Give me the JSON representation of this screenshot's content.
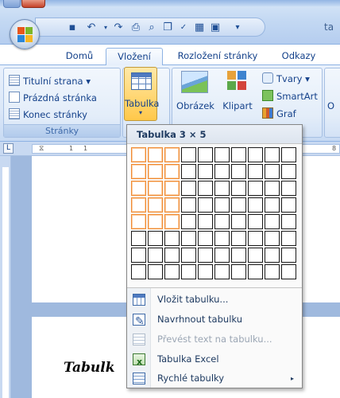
{
  "window": {
    "title_fragment": "ta"
  },
  "tabs": [
    {
      "label": "Domů",
      "active": false
    },
    {
      "label": "Vložení",
      "active": true
    },
    {
      "label": "Rozložení stránky",
      "active": false
    },
    {
      "label": "Odkazy",
      "active": false
    }
  ],
  "ribbon": {
    "pages_group": {
      "label": "Stránky",
      "items": [
        "Titulní strana ▾",
        "Prázdná stránka",
        "Konec stránky"
      ]
    },
    "table_button": {
      "label": "Tabulka",
      "arrow": "▾"
    },
    "picture_button": {
      "label": "Obrázek"
    },
    "clipart_button": {
      "label": "Klipart"
    },
    "shapes_button": {
      "label": "Tvary ▾"
    },
    "smartart_button": {
      "label": "SmartArt"
    },
    "chart_button": {
      "label": "Graf"
    },
    "cut_letter": "O"
  },
  "ruler": {
    "numbers": [
      "1",
      "1",
      "8"
    ]
  },
  "table_menu": {
    "header": "Tabulka 3 × 5",
    "grid": {
      "columns": 10,
      "rows": 8,
      "selected_columns": 3,
      "selected_rows": 5
    },
    "items": [
      {
        "label": "Vložit tabulku...",
        "icon": "insert-table-icon",
        "enabled": true
      },
      {
        "label": "Navrhnout tabulku",
        "icon": "draw-table-icon",
        "enabled": true
      },
      {
        "label": "Převést text na tabulku...",
        "icon": "convert-text-icon",
        "enabled": false
      },
      {
        "label": "Tabulka Excel",
        "icon": "excel-table-icon",
        "enabled": true
      },
      {
        "label": "Rychlé tabulky",
        "icon": "quick-tables-icon",
        "enabled": true,
        "submenu": "▸"
      }
    ]
  },
  "document": {
    "heading_fragment": "Tabulk"
  },
  "colors": {
    "accent": "#f08a32",
    "ribbon": "#dbe7f8",
    "text": "#15428b"
  }
}
